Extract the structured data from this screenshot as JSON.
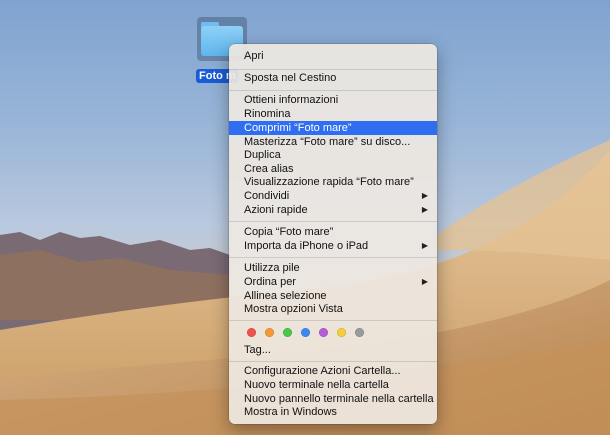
{
  "desktop": {
    "folder_label": "Foto m"
  },
  "context_menu": {
    "items": [
      {
        "label": "Apri"
      },
      {
        "label": "Sposta nel Cestino"
      },
      {
        "label": "Ottieni informazioni"
      },
      {
        "label": "Rinomina"
      },
      {
        "label": "Comprimi “Foto mare”",
        "selected": true
      },
      {
        "label": "Masterizza “Foto mare” su disco..."
      },
      {
        "label": "Duplica"
      },
      {
        "label": "Crea alias"
      },
      {
        "label": "Visualizzazione rapida “Foto mare”"
      },
      {
        "label": "Condividi",
        "submenu": true
      },
      {
        "label": "Azioni rapide",
        "submenu": true
      },
      {
        "label": "Copia “Foto mare”"
      },
      {
        "label": "Importa da iPhone o iPad",
        "submenu": true
      },
      {
        "label": "Utilizza pile"
      },
      {
        "label": "Ordina per",
        "submenu": true
      },
      {
        "label": "Allinea selezione"
      },
      {
        "label": "Mostra opzioni Vista"
      },
      {
        "label": "Tag..."
      },
      {
        "label": "Configurazione Azioni Cartella..."
      },
      {
        "label": "Nuovo terminale nella cartella"
      },
      {
        "label": "Nuovo pannello terminale nella cartella"
      },
      {
        "label": "Mostra in Windows"
      }
    ],
    "tag_colors": [
      "#f0514a",
      "#f49a34",
      "#48c84a",
      "#3e86f2",
      "#b45fd8",
      "#f4cd3a",
      "#9a9a9a"
    ],
    "submenu_arrow": "▶"
  }
}
